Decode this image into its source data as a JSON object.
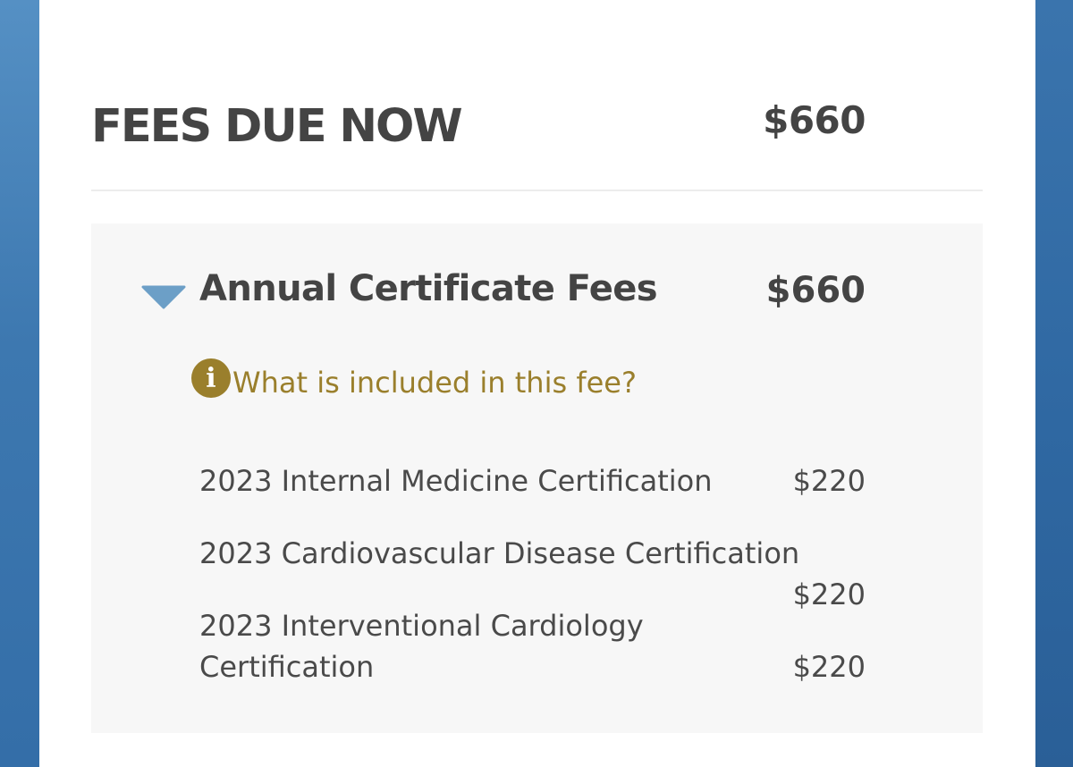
{
  "header": {
    "title": "FEES DUE NOW",
    "total": "$660"
  },
  "section": {
    "title": "Annual Certificate Fees",
    "amount": "$660",
    "toggle_icon": "triangle-down-icon",
    "toggle_color": "#6c9fc7",
    "info_icon": "info-icon",
    "info_link": "What is included in this fee?",
    "info_color": "#9a7f2c"
  },
  "items": [
    {
      "name": "2023 Internal Medicine Certification",
      "amount": "$220"
    },
    {
      "name": "2023 Cardiovascular Disease Certification",
      "amount": "$220"
    },
    {
      "name_line1": "2023 Interventional Cardiology",
      "name_line2": "Certification",
      "amount": "$220"
    }
  ]
}
